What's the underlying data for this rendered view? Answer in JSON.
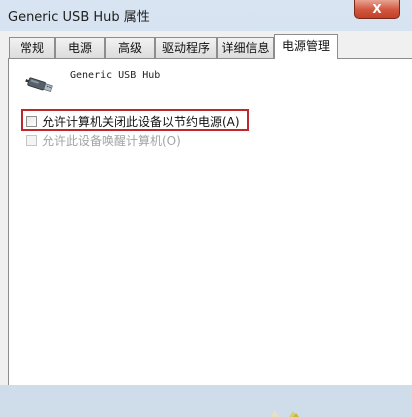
{
  "window": {
    "title": "Generic USB Hub 属性",
    "close_glyph": "X"
  },
  "tabs": [
    {
      "label": "常规",
      "active": false
    },
    {
      "label": "电源",
      "active": false
    },
    {
      "label": "高级",
      "active": false
    },
    {
      "label": "驱动程序",
      "active": false
    },
    {
      "label": "详细信息",
      "active": false
    },
    {
      "label": "电源管理",
      "active": true
    }
  ],
  "device": {
    "name": "Generic USB Hub",
    "icon": "usb-plug-icon"
  },
  "options": [
    {
      "label": "允许计算机关闭此设备以节约电源(A)",
      "checked": false,
      "enabled": true,
      "highlighted": true
    },
    {
      "label": "允许此设备唤醒计算机(O)",
      "checked": false,
      "enabled": false,
      "highlighted": false
    }
  ],
  "colors": {
    "highlight": "#c0262a",
    "close_button": "#d2553e"
  }
}
